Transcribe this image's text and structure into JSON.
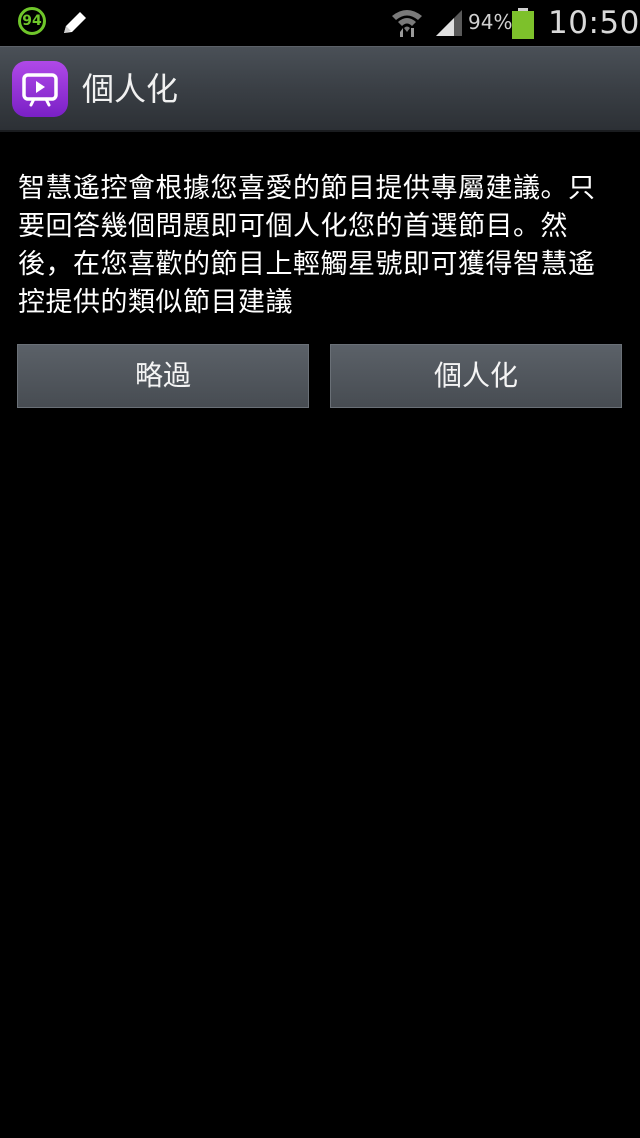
{
  "status_bar": {
    "notification_badge": "94",
    "battery_percent": "94%",
    "time": "10:50",
    "icons": [
      "badge-icon",
      "pencil-icon",
      "wifi-icon",
      "signal-icon",
      "battery-icon"
    ],
    "colors": {
      "badge": "#6fc62a",
      "battery": "#7dc12b"
    }
  },
  "action_bar": {
    "title": "個人化",
    "app_icon": "tv-app-icon",
    "colors": {
      "icon_gradient_top": "#b049e8",
      "icon_gradient_bottom": "#7a20c6"
    }
  },
  "main": {
    "description": "智慧遙控會根據您喜愛的節目提供專屬建議。只要回答幾個問題即可個人化您的首選節目。然後，在您喜歡的節目上輕觸星號即可獲得智慧遙控提供的類似節目建議",
    "buttons": {
      "skip_label": "略過",
      "personalize_label": "個人化"
    }
  }
}
